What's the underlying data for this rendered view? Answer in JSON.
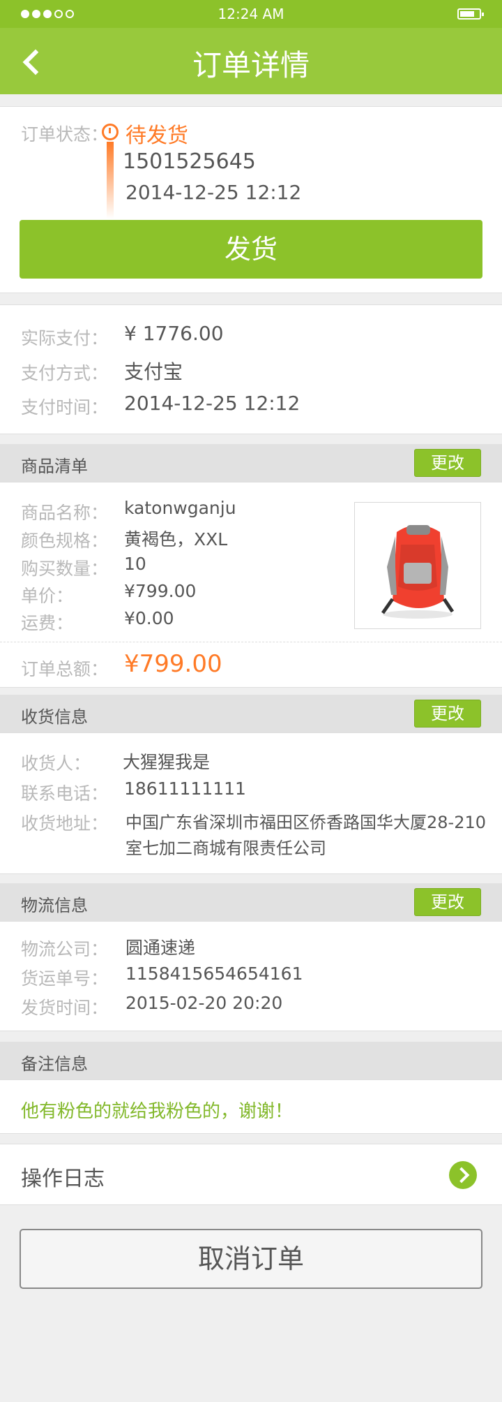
{
  "status_bar": {
    "time": "12:24 AM"
  },
  "nav": {
    "title": "订单详情"
  },
  "order_status": {
    "label": "订单状态：",
    "status": "待发货",
    "order_no": "1501525645",
    "time": "2014-12-25 12:12",
    "ship_button": "发货"
  },
  "payment": [
    {
      "label": "实际支付：",
      "value": "¥ 1776.00"
    },
    {
      "label": "支付方式：",
      "value": "支付宝"
    },
    {
      "label": "支付时间：",
      "value": "2014-12-25 12:12"
    }
  ],
  "goods": {
    "title": "商品清单",
    "edit": "更改",
    "rows": [
      {
        "label": "商品名称：",
        "value": "katonwganju"
      },
      {
        "label": "颜色规格：",
        "value": "黄褐色，XXL"
      },
      {
        "label": "购买数量：",
        "value": "10"
      },
      {
        "label": "单价：",
        "value": "¥799.00"
      },
      {
        "label": "运费：",
        "value": "¥0.00"
      }
    ],
    "total_label": "订单总额：",
    "total_value": "¥799.00"
  },
  "shipping": {
    "title": "收货信息",
    "edit": "更改",
    "rows": [
      {
        "label": "收货人：",
        "value": "大猩猩我是"
      },
      {
        "label": "联系电话：",
        "value": "18611111111"
      },
      {
        "label": "收货地址：",
        "value": "中国广东省深圳市福田区侨香路国华大厦28-210"
      }
    ],
    "address_line2": "室七加二商城有限责任公司"
  },
  "logistics": {
    "title": "物流信息",
    "edit": "更改",
    "rows": [
      {
        "label": "物流公司：",
        "value": "圆通速递"
      },
      {
        "label": "货运单号：",
        "value": "1158415654654161"
      },
      {
        "label": "发货时间：",
        "value": "2015-02-20 20:20"
      }
    ]
  },
  "remark": {
    "title": "备注信息",
    "text": "他有粉色的就给我粉色的，谢谢！"
  },
  "log": {
    "title": "操作日志"
  },
  "cancel_button": "取消订单",
  "colors": {
    "brand_green": "#8cc22a",
    "highlight_orange": "#ff7a26"
  }
}
